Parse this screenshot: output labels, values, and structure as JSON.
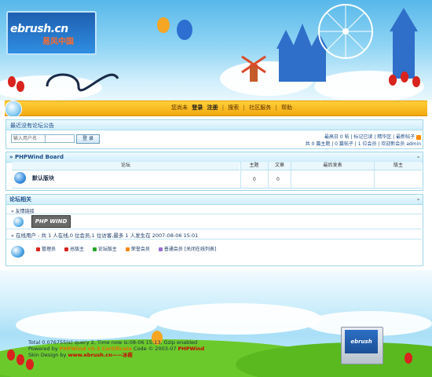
{
  "header": {
    "logo_text": "ebrush.cn",
    "logo_subtitle": "易风中国"
  },
  "nav": {
    "items": [
      "您尚未",
      "登录",
      "注册",
      "搜索",
      "社区服务",
      "帮助"
    ],
    "separators": [
      "|",
      "|",
      "|"
    ]
  },
  "notice": {
    "title": "最近没有论坛公告"
  },
  "login": {
    "username_placeholder": "输入用户名",
    "button_label": "登 录"
  },
  "stats": {
    "line1": "最高日 0 帖 | 标记已读 | 精华区 | 最新帖子",
    "line2": "共 0 篇主题 | 0 篇帖子 | 1 位会员 | 欢迎新会员 admin"
  },
  "board_section": {
    "title": "» PHPWind Board",
    "collapse": "-",
    "columns": [
      "论坛",
      "主题",
      "文章",
      "最后发表",
      "版主"
    ],
    "rows": [
      {
        "name": "默认版块",
        "topics": "0",
        "posts": "0",
        "last_post": "",
        "moderator": ""
      }
    ]
  },
  "related_section": {
    "title": "论坛相关",
    "collapse": "-",
    "links_label": "» 友情链接",
    "partner_logo": "PHP WIND",
    "online_line": "» 在线用户 - 共 1 人在线,0 位会员,1 位访客,最多 1 人发生在 2007-08-06 15:01",
    "legend": [
      "管理员",
      "总版主",
      "论坛版主",
      "荣誉会员",
      "普通会员 [关闭在线列表]"
    ]
  },
  "footer": {
    "line1": "Total 0.076755(s) query 2, Time now is:08-06 15:13, Gzip enabled",
    "line2_prefix": "Powered by ",
    "line2_brand": "PHPWind v5.3 Certificate",
    "line2_mid": " Code © 2003-07 ",
    "line2_end": "PHPWind",
    "line3_prefix": "Skin Design by ",
    "line3_link": "www.ebrush.cn——冰莜",
    "monitor_logo": "ebrush"
  },
  "colors": {
    "nav_bar": "#f2a90e",
    "panel_border": "#9fd6ea",
    "header_sky": "#58b8ea",
    "grass": "#5fbe25"
  }
}
